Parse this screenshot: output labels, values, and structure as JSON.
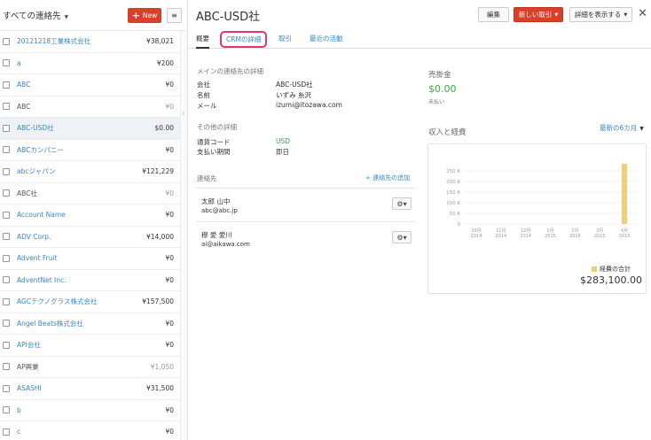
{
  "left_panel": {
    "title": "すべての連絡先",
    "new_button": "New",
    "rows": [
      {
        "name": "20121218工業株式会社",
        "amount": "¥38,021",
        "link": true,
        "muted": false
      },
      {
        "name": "a",
        "amount": "¥200",
        "link": true,
        "muted": false
      },
      {
        "name": "ABC",
        "amount": "¥0",
        "link": true,
        "muted": false
      },
      {
        "name": "ABC",
        "amount": "¥0",
        "link": false,
        "muted": true
      },
      {
        "name": "ABC-USD社",
        "amount": "$0.00",
        "link": true,
        "muted": false
      },
      {
        "name": "ABCカンパニー",
        "amount": "¥0",
        "link": true,
        "muted": false
      },
      {
        "name": "abcジャパン",
        "amount": "¥121,229",
        "link": true,
        "muted": false
      },
      {
        "name": "ABC社",
        "amount": "¥0",
        "link": false,
        "muted": true
      },
      {
        "name": "Account Name",
        "amount": "¥0",
        "link": true,
        "muted": false
      },
      {
        "name": "ADV Corp.",
        "amount": "¥14,000",
        "link": true,
        "muted": false
      },
      {
        "name": "Advent Fruit",
        "amount": "¥0",
        "link": true,
        "muted": false
      },
      {
        "name": "AdventNet Inc.",
        "amount": "¥0",
        "link": true,
        "muted": false
      },
      {
        "name": "AGCテクノグラス株式会社",
        "amount": "¥157,500",
        "link": true,
        "muted": false
      },
      {
        "name": "Angel Beats株式会社",
        "amount": "¥0",
        "link": true,
        "muted": false
      },
      {
        "name": "API会社",
        "amount": "¥0",
        "link": true,
        "muted": false
      },
      {
        "name": "AP興業",
        "amount": "¥1,050",
        "link": false,
        "muted": true
      },
      {
        "name": "ASASHI",
        "amount": "¥31,500",
        "link": true,
        "muted": false
      },
      {
        "name": "b",
        "amount": "¥0",
        "link": true,
        "muted": false
      },
      {
        "name": "c",
        "amount": "¥0",
        "link": true,
        "muted": false
      }
    ]
  },
  "header": {
    "title": "ABC-USD社",
    "edit_button": "編集",
    "new_deal_button": "新しい取引",
    "details_button": "詳細を表示する"
  },
  "tabs": [
    {
      "label": "概要"
    },
    {
      "label": "CRMの詳細"
    },
    {
      "label": "取引"
    },
    {
      "label": "最近の活動"
    }
  ],
  "main_contact": {
    "section_title": "メインの連絡先の詳細",
    "company_label": "会社",
    "company_value": "ABC-USD社",
    "name_label": "名前",
    "name_value": "いずみ 糸沢",
    "email_label": "メール",
    "email_value": "izumi@itozawa.com"
  },
  "other_details": {
    "section_title": "その他の詳細",
    "currency_label": "通貨コード",
    "currency_value": "USD",
    "payment_label": "支払い期間",
    "payment_value": "即日"
  },
  "contacts": {
    "section_title": "連絡先",
    "add_link": "+ 連絡先の追加",
    "items": [
      {
        "name": "太郎 山中",
        "email": "abc@abc.jp"
      },
      {
        "name": "穆 愛 愛川",
        "email": "ai@aikawa.com"
      }
    ]
  },
  "receivables": {
    "title": "売掛金",
    "amount": "$0.00",
    "status": "未払い"
  },
  "income_expense": {
    "title": "収入と経費",
    "period_dropdown": "最新の6カ月"
  },
  "chart_data": {
    "type": "bar",
    "categories": [
      "10月\n2014",
      "11月\n2014",
      "12月\n2014",
      "1月\n2015",
      "2月\n2015",
      "3月\n2015",
      "4月\n2015"
    ],
    "series": [
      {
        "name": "経費の合計",
        "values": [
          0,
          0,
          0,
          0,
          0,
          0,
          283100
        ]
      }
    ],
    "ytick_labels": [
      "250 K",
      "200 K",
      "150 K",
      "100 K",
      "50 K",
      "0"
    ],
    "yticks": [
      250000,
      200000,
      150000,
      100000,
      50000,
      0
    ],
    "ylim": [
      0,
      300000
    ],
    "bar_color": "#f0cf73",
    "total_label": "$283,100.00"
  },
  "colors": {
    "accent_red": "#d9402b",
    "link_blue": "#3a87c8",
    "highlight_pink": "#e0356f",
    "green": "#3aa845"
  }
}
